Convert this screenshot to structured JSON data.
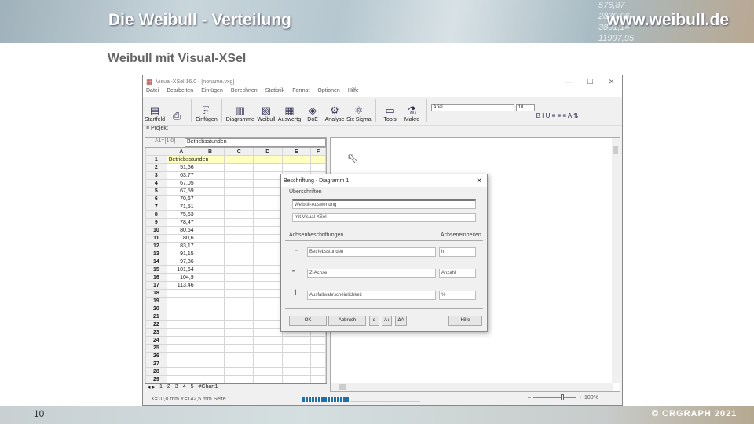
{
  "banner": {
    "title": "Die Weibull - Verteilung",
    "url": "www.weibull.de",
    "bg_numbers": [
      "576,87",
      "2879,96",
      "3891,14",
      "11997,95"
    ]
  },
  "subtitle": "Weibull mit Visual-XSel",
  "app": {
    "title": "Visual-XSel 16.0 - [noname.vxg]",
    "window_buttons": [
      "—",
      "☐",
      "✕"
    ],
    "menu": [
      "Datei",
      "Bearbeiten",
      "Einfügen",
      "Berechnen",
      "Statistik",
      "Format",
      "Optionen",
      "Hilfe"
    ],
    "ribbon": [
      {
        "icon": "▤",
        "label": "Startfeld"
      },
      {
        "icon": "⎘",
        "label": "Einfügen"
      },
      {
        "icon": "▥",
        "label": "Diagramme"
      },
      {
        "icon": "▧",
        "label": "Weibull"
      },
      {
        "icon": "▦",
        "label": "Auswertg"
      },
      {
        "icon": "◈",
        "label": "DoE"
      },
      {
        "icon": "⚙",
        "label": "Analyse"
      },
      {
        "icon": "⚛",
        "label": "Six Sigma"
      },
      {
        "icon": "▭",
        "label": "Tools"
      },
      {
        "icon": "⚗",
        "label": "Makro"
      }
    ],
    "font_name": "Arial",
    "font_size": "10",
    "projekt": "≡ Projekt",
    "cell_ref": "A1=[1,0]",
    "formula_value": "Betriebsstunden",
    "columns": [
      "A",
      "B",
      "C",
      "D",
      "E",
      "F"
    ],
    "header_cell": "Betriebsstunden",
    "values": [
      "51,66",
      "63,77",
      "67,05",
      "67,59",
      "70,67",
      "71,51",
      "75,63",
      "78,47",
      "80,64",
      "80,6",
      "83,17",
      "91,15",
      "97,36",
      "101,64",
      "104,9",
      "113,46"
    ],
    "row_count": 29,
    "sheet_tabs": [
      "1",
      "2",
      "3",
      "4",
      "5",
      "#Chart1"
    ],
    "status": "X=10,0 mm  Y=142,5 mm   Seite 1",
    "progress_percent": 40,
    "zoom": "100%"
  },
  "dialog": {
    "title": "Beschriftung - Diagramm 1",
    "close": "✕",
    "section_titles": "Überschriften",
    "title1": "Weibull-Auswertung",
    "title2": "mit Visual-XSel",
    "section_axes": "Achsenbeschriftungen",
    "section_units": "Achseneinheiten",
    "x_label": "Betriebsstunden",
    "x_unit": "h",
    "z_label": "Z-Achse",
    "z_unit": "Anzahl",
    "y_label": "Ausfallwahrscheinlichkeit",
    "y_unit": "%",
    "ok": "OK",
    "cancel": "Abbruch",
    "help": "Hilfe",
    "tool_buttons": [
      "α",
      "A↕",
      "ΔA"
    ]
  },
  "footer": {
    "page": "10",
    "copyright": "© CRGRAPH 2021"
  }
}
